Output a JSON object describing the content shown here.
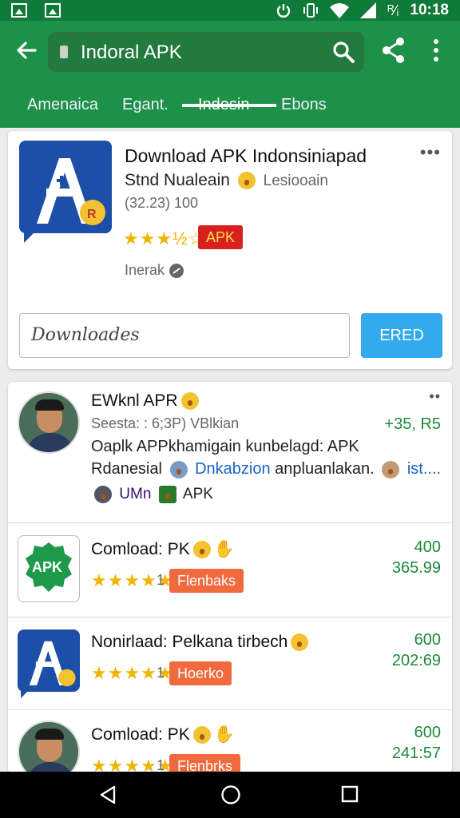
{
  "status": {
    "time": "10:18",
    "battery_label": "ᴿ⁄ᵢ"
  },
  "search": {
    "query": "Indoral APK"
  },
  "tabs": [
    {
      "label": "Amenaica"
    },
    {
      "label": "Egant."
    },
    {
      "label": "Indesin"
    },
    {
      "label": "Ebons"
    }
  ],
  "featured": {
    "title": "Download APK Indonsiniapad",
    "developer": "Stnd Nualeain",
    "developer_sub": "Lesiooain",
    "meta": "(32.23) 100",
    "badge": "APK",
    "label": "Inerak",
    "input_value": "Downloades",
    "button": "ERED"
  },
  "list": [
    {
      "title": "EWknl APR",
      "line1": "Seesta: : 6;3P) VBlkian",
      "price_top": "+35, R5",
      "desc1": "Oaplk APPkhamigain kunbelagd: APK",
      "desc2_a": "Rdanesial",
      "desc2_b": "Dnkabzion",
      "desc2_c": "anpluanlakan.",
      "desc2_d": "ist....",
      "tag1": "UMn",
      "tag2": "APK"
    },
    {
      "title": "Comload: PK",
      "rating_num": "1",
      "badge": "Flenbaks",
      "price_top": "400",
      "price_bottom": "365.99"
    },
    {
      "title": "Nonirlaad: Pelkana tirbech",
      "rating_num": "1",
      "badge": "Hoerko",
      "price_top": "600",
      "price_bottom": "202:69"
    },
    {
      "title": "Comload: PK",
      "rating_num": "1",
      "badge": "Flenbrks",
      "price_top": "600",
      "price_bottom": "241:57"
    }
  ],
  "colors": {
    "status_bar": "#0f7a3a",
    "app_bar": "#1e9148",
    "accent_blue": "#33aaee",
    "price_green": "#1d8a3c",
    "badge_red": "#d8201e",
    "badge_orange": "#f06a3e"
  },
  "icons": [
    "image-icon",
    "gallery-icon",
    "power-icon",
    "vibrate-icon",
    "wifi-icon",
    "signal-icon",
    "back-arrow-icon",
    "lock-icon",
    "search-icon",
    "share-icon",
    "more-vert-icon",
    "nav-back-icon",
    "nav-home-icon",
    "nav-recents-icon"
  ]
}
